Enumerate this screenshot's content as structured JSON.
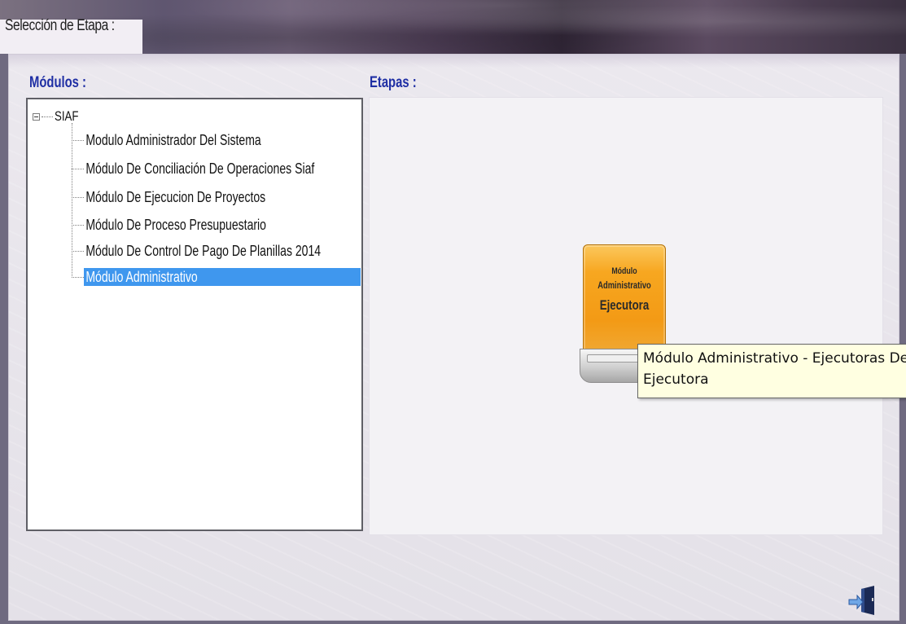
{
  "window": {
    "title": "Selección de Etapa :"
  },
  "modules_panel": {
    "label": "Módulos :",
    "root": "SIAF",
    "items": [
      {
        "label": "Modulo Administrador Del Sistema",
        "selected": false
      },
      {
        "label": "Módulo De Conciliación De Operaciones Siaf",
        "selected": false
      },
      {
        "label": "Módulo De Ejecucion De Proyectos",
        "selected": false
      },
      {
        "label": "Módulo De Proceso Presupuestario",
        "selected": false
      },
      {
        "label": "Módulo De Control De Pago De Planillas 2014",
        "selected": false
      },
      {
        "label": "Módulo Administrativo",
        "selected": true
      }
    ]
  },
  "stages_panel": {
    "label": "Etapas :",
    "tile": {
      "line1": "Módulo",
      "line2": "Administrativo",
      "line3": "Ejecutora"
    },
    "tooltip": {
      "line1": "Módulo Administrativo - Ejecutoras Del Gobierno",
      "line2": "Ejecutora"
    }
  },
  "actions": {
    "exit_icon": "exit-door-icon"
  },
  "colors": {
    "label_blue": "#1f2fa4",
    "selection": "#3f97ee",
    "tile_orange": "#f39a15",
    "tooltip_bg": "#ffffe1"
  }
}
